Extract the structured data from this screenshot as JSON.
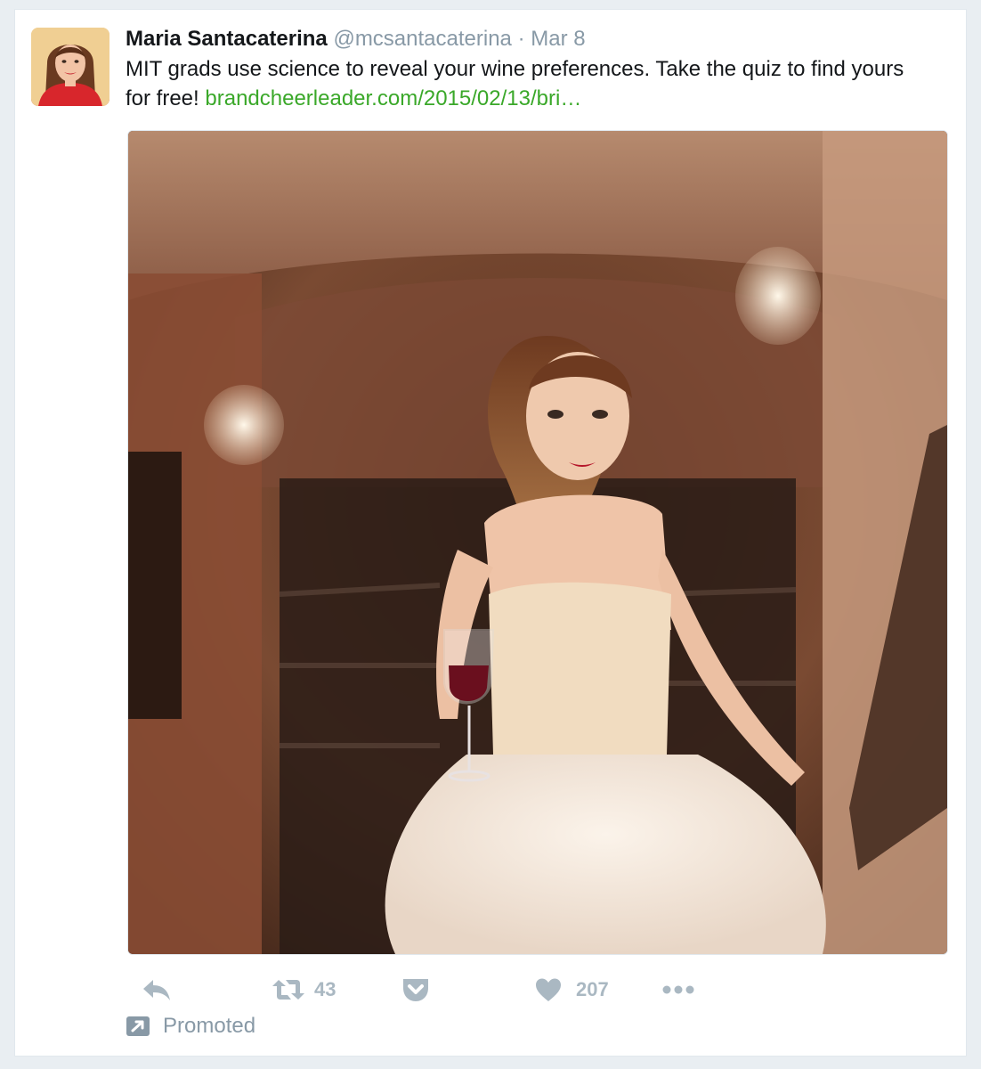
{
  "tweet": {
    "author_name": "Maria Santacaterina",
    "handle": "@mcsantacaterina",
    "separator": "·",
    "date": "Mar 8",
    "text": "MIT grads use science to reveal your wine preferences. Take the quiz to find yours for free! ",
    "link": "brandcheerleader.com/2015/02/13/bri…"
  },
  "actions": {
    "reply_icon": "reply-icon",
    "retweet_icon": "retweet-icon",
    "retweet_count": "43",
    "pocket_icon": "pocket-icon",
    "like_icon": "heart-icon",
    "like_count": "207",
    "more_icon": "more-dots-icon"
  },
  "promoted": {
    "icon": "promoted-arrow-icon",
    "label": "Promoted"
  },
  "colors": {
    "link": "#3aa829",
    "muted": "#8899a6",
    "action": "#aab8c2"
  }
}
